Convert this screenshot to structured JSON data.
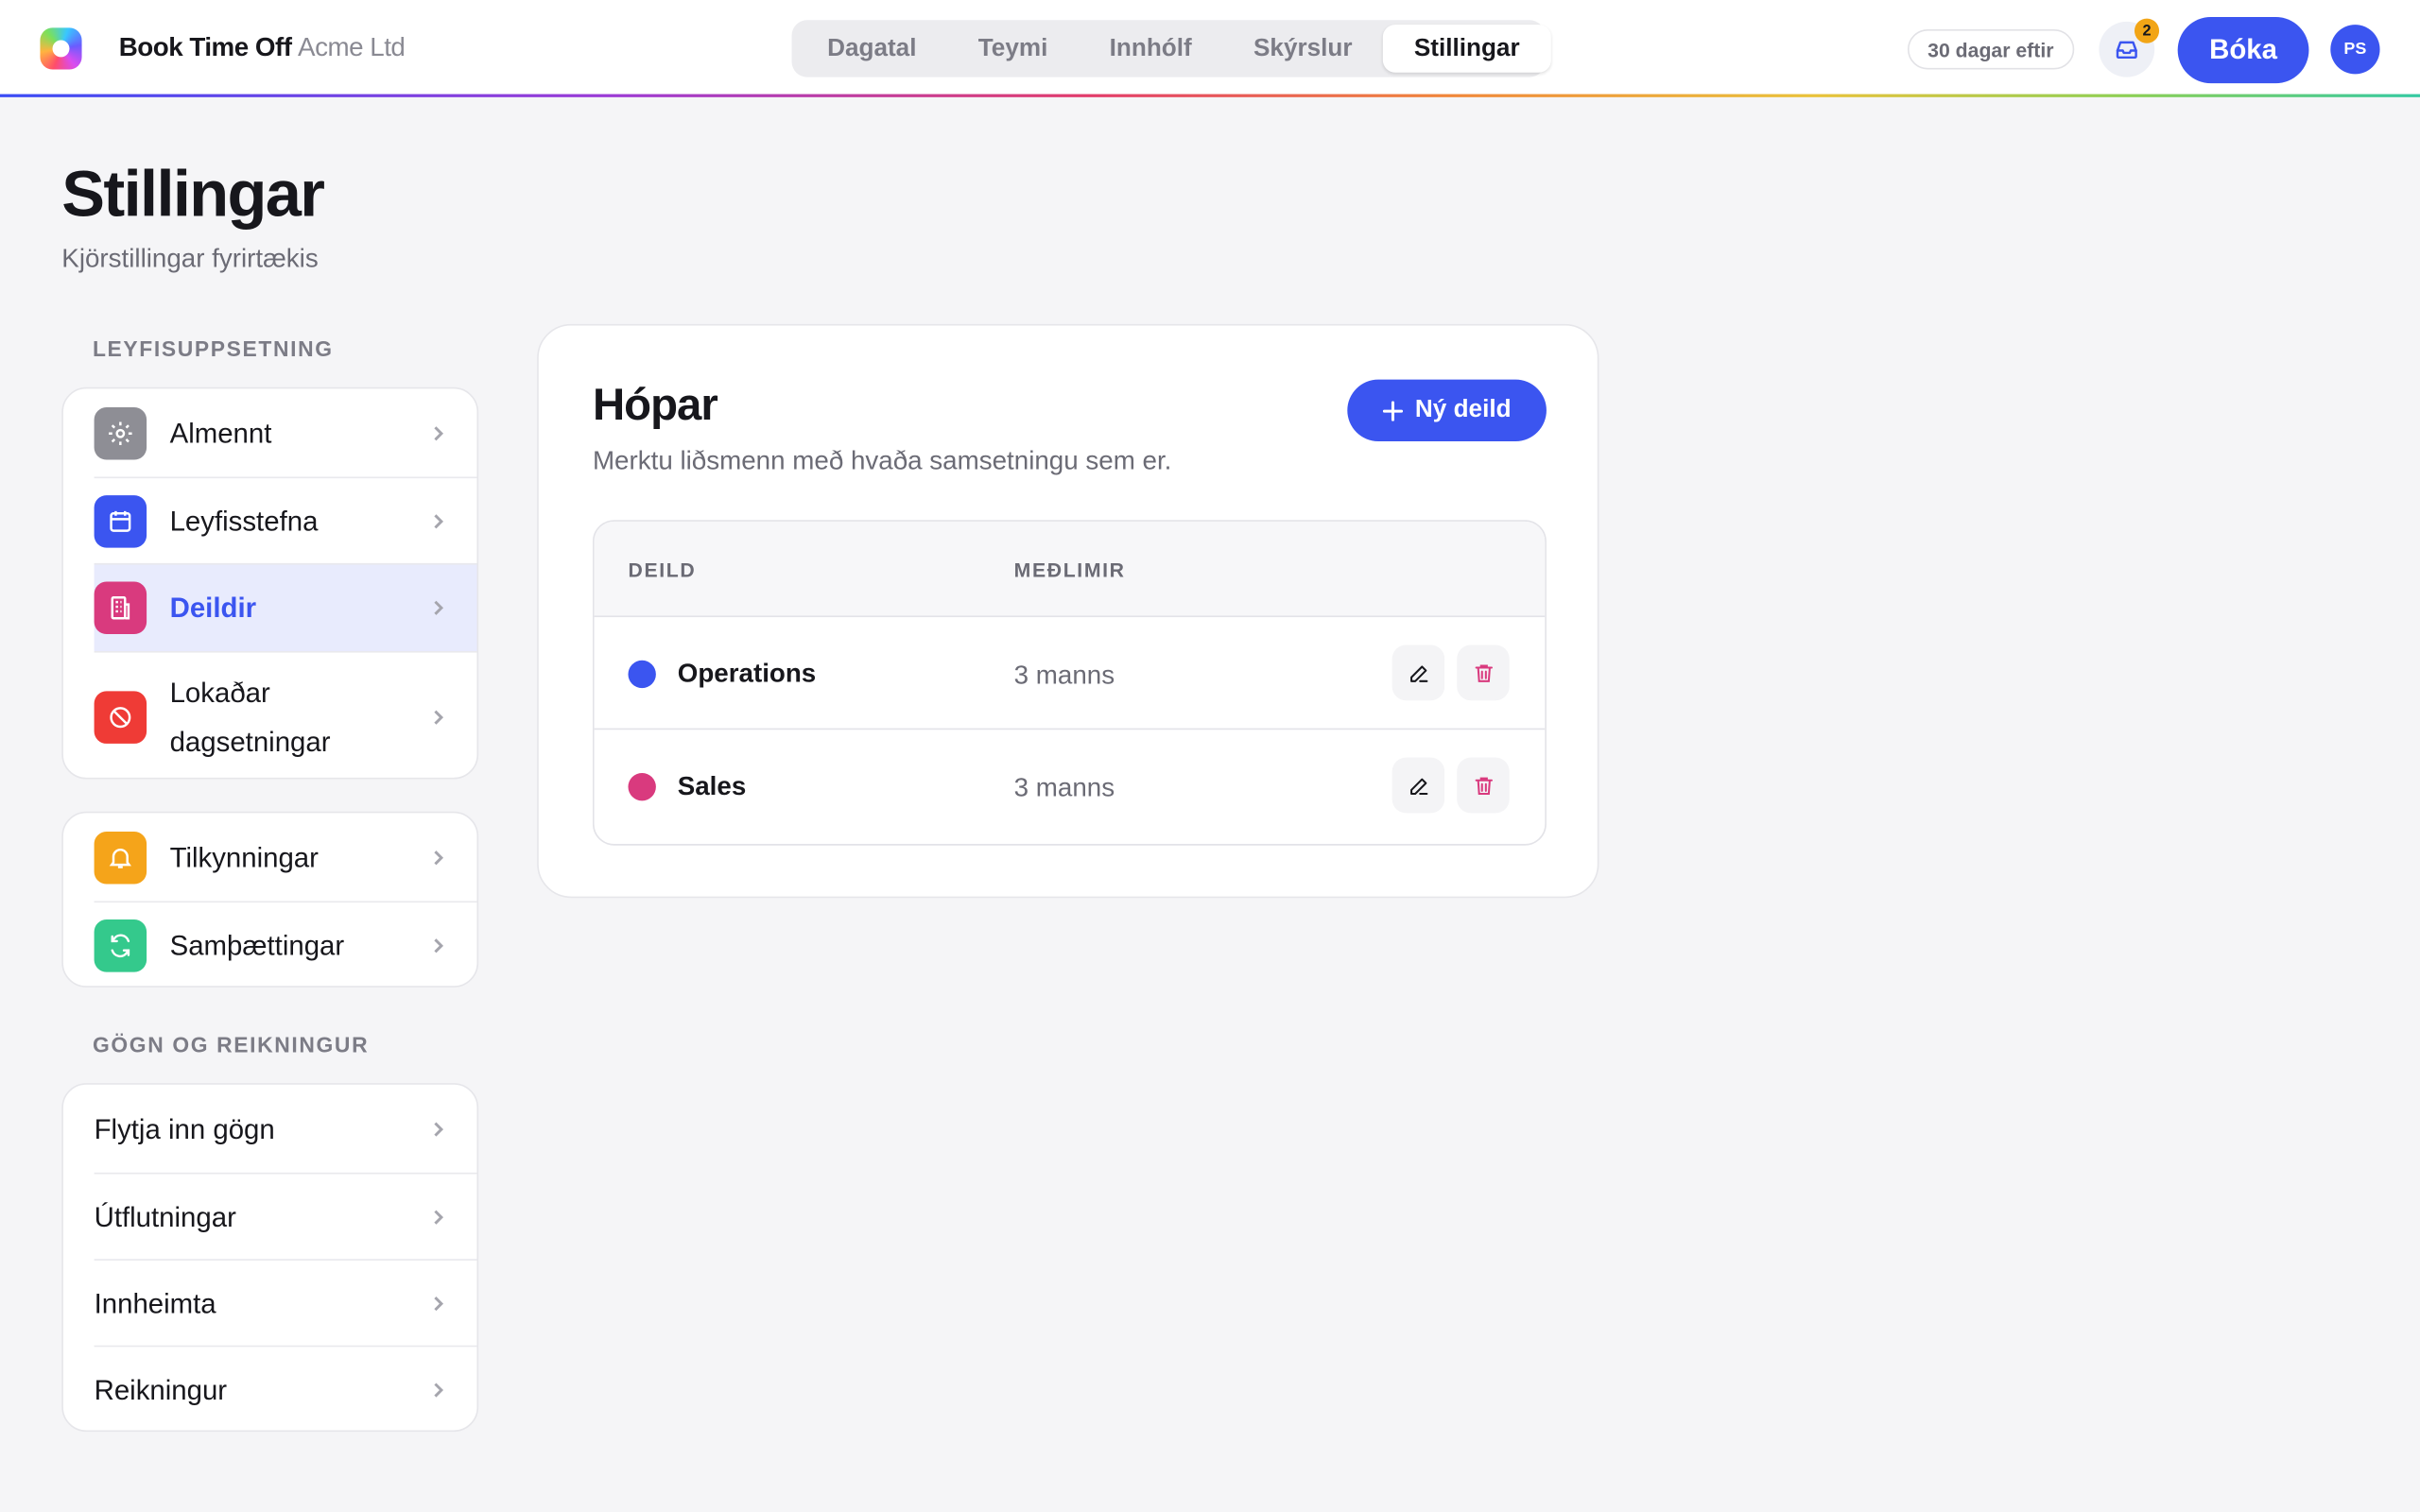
{
  "header": {
    "brand": "Book Time Off",
    "company": "Acme Ltd",
    "tabs": [
      {
        "label": "Dagatal"
      },
      {
        "label": "Teymi"
      },
      {
        "label": "Innhólf"
      },
      {
        "label": "Skýrslur"
      },
      {
        "label": "Stillingar",
        "active": true
      }
    ],
    "trial": "30 dagar eftir",
    "inbox_badge": "2",
    "book_label": "Bóka",
    "avatar_initials": "PS"
  },
  "page": {
    "title": "Stillingar",
    "subtitle": "Kjörstillingar fyrirtækis"
  },
  "sidebar": {
    "section1_label": "LEYFISUPPSETNING",
    "group1": [
      {
        "label": "Almennt",
        "icon": "gear-icon",
        "color": "#8e8e95"
      },
      {
        "label": "Leyfisstefna",
        "icon": "calendar-icon",
        "color": "#3b55f0"
      },
      {
        "label": "Deildir",
        "icon": "building-icon",
        "color": "#d93a7e",
        "active": true
      },
      {
        "label": "Lokaðar dagsetningar",
        "line1": "Lokaðar",
        "line2": "dagsetningar",
        "icon": "block-icon",
        "color": "#ef3b36"
      }
    ],
    "group2": [
      {
        "label": "Tilkynningar",
        "icon": "bell-icon",
        "color": "#f5a41a"
      },
      {
        "label": "Samþættingar",
        "icon": "sync-icon",
        "color": "#34c98c"
      }
    ],
    "section2_label": "GÖGN OG REIKNINGUR",
    "group3": [
      {
        "label": "Flytja inn gögn"
      },
      {
        "label": "Útflutningar"
      },
      {
        "label": "Innheimta"
      },
      {
        "label": "Reikningur"
      }
    ]
  },
  "main": {
    "title": "Hópar",
    "subtitle": "Merktu liðsmenn með hvaða samsetningu sem er.",
    "new_button": "Ný deild",
    "table": {
      "columns": [
        "DEILD",
        "MEÐLIMIR"
      ],
      "rows": [
        {
          "name": "Operations",
          "members": "3 manns",
          "color": "#3b55f0"
        },
        {
          "name": "Sales",
          "members": "3 manns",
          "color": "#d93a7e"
        }
      ]
    }
  }
}
